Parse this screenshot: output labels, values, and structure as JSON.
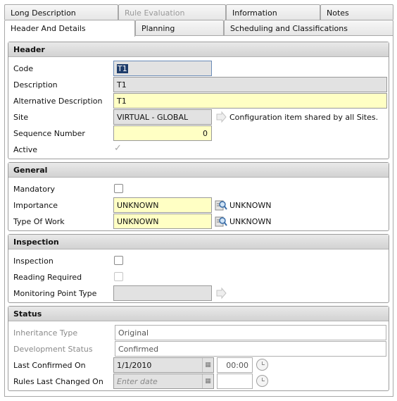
{
  "tabs_row1": [
    {
      "label": "Long Description",
      "disabled": false
    },
    {
      "label": "Rule Evaluation",
      "disabled": true
    },
    {
      "label": "Information",
      "disabled": false
    },
    {
      "label": "Notes",
      "disabled": false
    }
  ],
  "tabs_row2": [
    {
      "label": "Header And Details",
      "active": true
    },
    {
      "label": "Planning",
      "active": false
    },
    {
      "label": "Scheduling and Classifications",
      "active": false
    }
  ],
  "header": {
    "title": "Header",
    "code_label": "Code",
    "code_value": "T1",
    "description_label": "Description",
    "description_value": "T1",
    "alt_description_label": "Alternative Description",
    "alt_description_value": "T1",
    "site_label": "Site",
    "site_value": "VIRTUAL - GLOBAL",
    "site_note": "Configuration item shared by all Sites.",
    "sequence_label": "Sequence Number",
    "sequence_value": "0",
    "active_label": "Active",
    "active_checked": true
  },
  "general": {
    "title": "General",
    "mandatory_label": "Mandatory",
    "mandatory_checked": false,
    "importance_label": "Importance",
    "importance_value": "UNKNOWN",
    "importance_desc": "UNKNOWN",
    "type_of_work_label": "Type Of Work",
    "type_of_work_value": "UNKNOWN",
    "type_of_work_desc": "UNKNOWN"
  },
  "inspection": {
    "title": "Inspection",
    "inspection_label": "Inspection",
    "inspection_checked": false,
    "reading_required_label": "Reading Required",
    "reading_required_checked": false,
    "monitoring_point_label": "Monitoring Point Type",
    "monitoring_point_value": ""
  },
  "status": {
    "title": "Status",
    "inheritance_label": "Inheritance Type",
    "inheritance_value": "Original",
    "development_label": "Development Status",
    "development_value": "Confirmed",
    "last_confirmed_label": "Last Confirmed On",
    "last_confirmed_date": "1/1/2010",
    "last_confirmed_time": "00:00",
    "rules_changed_label": "Rules Last Changed On",
    "rules_changed_placeholder": "Enter date",
    "rules_changed_time": ""
  },
  "icons": {
    "lookup": "lookup-icon",
    "info_arrow": "info-arrow-icon",
    "calendar": "calendar-icon",
    "clock": "clock-icon"
  },
  "colors": {
    "required_field": "#ffffc4",
    "readonly_field": "#e2e2e2",
    "section_header": "#d8d8d8"
  }
}
